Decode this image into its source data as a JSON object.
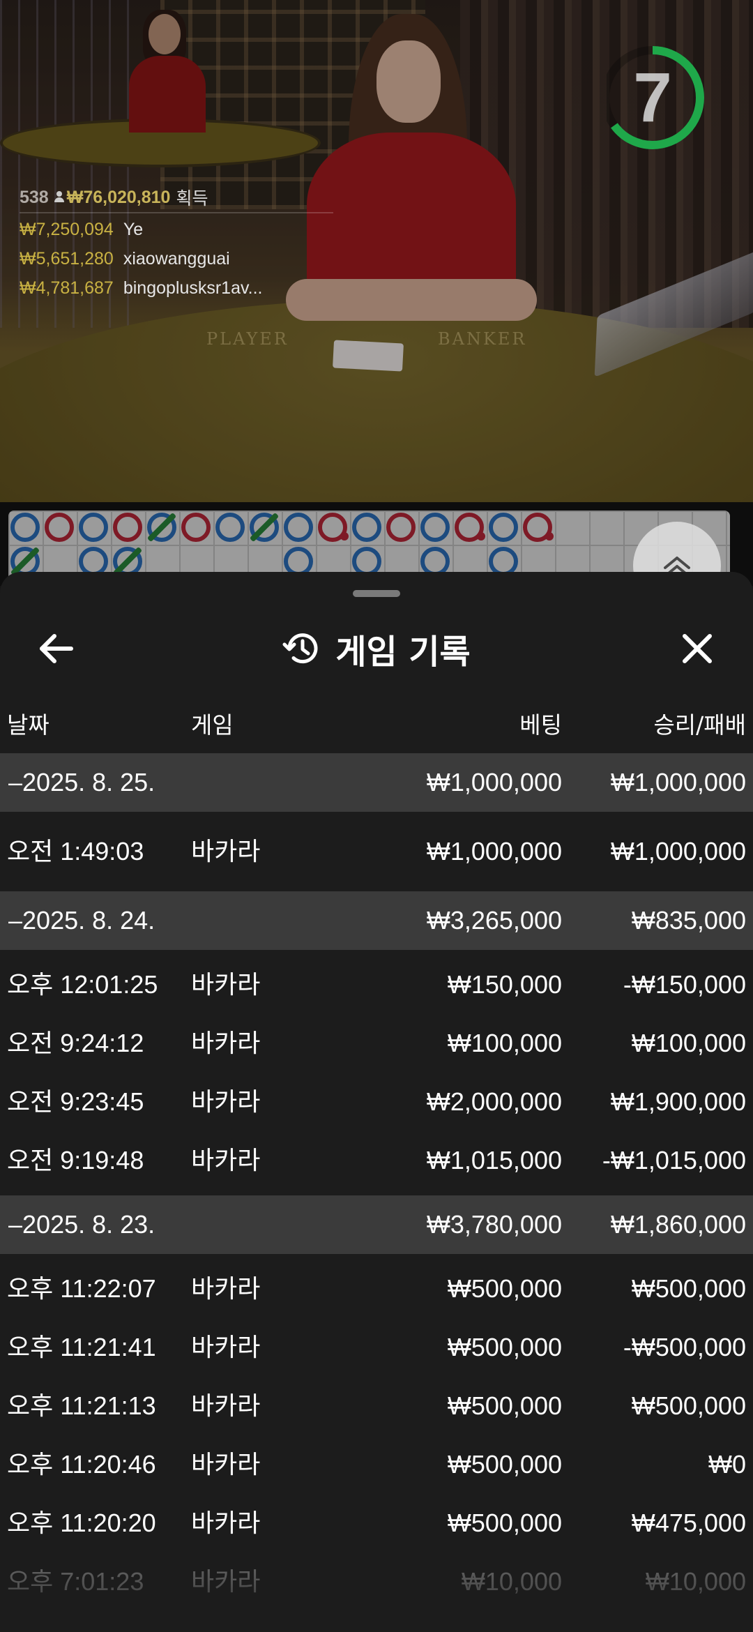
{
  "video": {
    "felt_labels": {
      "player": "PLAYER",
      "banker": "BANKER"
    }
  },
  "timer": {
    "value": "7",
    "progress": 0.65,
    "color": "#1fa84a"
  },
  "winners": {
    "count": "538",
    "total": "₩76,020,810",
    "label": "획득",
    "list": [
      {
        "amount": "₩7,250,094",
        "name": "Ye"
      },
      {
        "amount": "₩5,651,280",
        "name": "xiaowangguai"
      },
      {
        "amount": "₩4,781,687",
        "name": "bingoplusksr1av..."
      }
    ]
  },
  "roadmap": {
    "colors": {
      "player": "#2d73c4",
      "banker": "#c2293b",
      "tie": "#2a8c3c"
    }
  },
  "sheet": {
    "title": "게임 기록",
    "icons": {
      "back": "arrow-left-icon",
      "history": "history-icon",
      "close": "close-icon"
    }
  },
  "history": {
    "columns": {
      "date": "날짜",
      "game": "게임",
      "bet": "베팅",
      "win_loss": "승리/패배"
    },
    "groups": [
      {
        "date": "–2025. 8. 25.",
        "bet": "₩1,000,000",
        "win_loss": "₩1,000,000",
        "items": [
          {
            "time": "오전 1:49:03",
            "game": "바카라",
            "bet": "₩1,000,000",
            "win_loss": "₩1,000,000"
          }
        ]
      },
      {
        "date": "–2025. 8. 24.",
        "bet": "₩3,265,000",
        "win_loss": "₩835,000",
        "items": [
          {
            "time": "오후 12:01:25",
            "game": "바카라",
            "bet": "₩150,000",
            "win_loss": "-₩150,000"
          },
          {
            "time": "오전 9:24:12",
            "game": "바카라",
            "bet": "₩100,000",
            "win_loss": "₩100,000"
          },
          {
            "time": "오전 9:23:45",
            "game": "바카라",
            "bet": "₩2,000,000",
            "win_loss": "₩1,900,000"
          },
          {
            "time": "오전 9:19:48",
            "game": "바카라",
            "bet": "₩1,015,000",
            "win_loss": "-₩1,015,000"
          }
        ]
      },
      {
        "date": "–2025. 8. 23.",
        "bet": "₩3,780,000",
        "win_loss": "₩1,860,000",
        "items": [
          {
            "time": "오후 11:22:07",
            "game": "바카라",
            "bet": "₩500,000",
            "win_loss": "₩500,000"
          },
          {
            "time": "오후 11:21:41",
            "game": "바카라",
            "bet": "₩500,000",
            "win_loss": "-₩500,000"
          },
          {
            "time": "오후 11:21:13",
            "game": "바카라",
            "bet": "₩500,000",
            "win_loss": "₩500,000"
          },
          {
            "time": "오후 11:20:46",
            "game": "바카라",
            "bet": "₩500,000",
            "win_loss": "₩0"
          },
          {
            "time": "오후 11:20:20",
            "game": "바카라",
            "bet": "₩500,000",
            "win_loss": "₩475,000"
          },
          {
            "time": "오후 7:01:23",
            "game": "바카라",
            "bet": "₩10,000",
            "win_loss": "₩10,000"
          }
        ]
      }
    ]
  }
}
